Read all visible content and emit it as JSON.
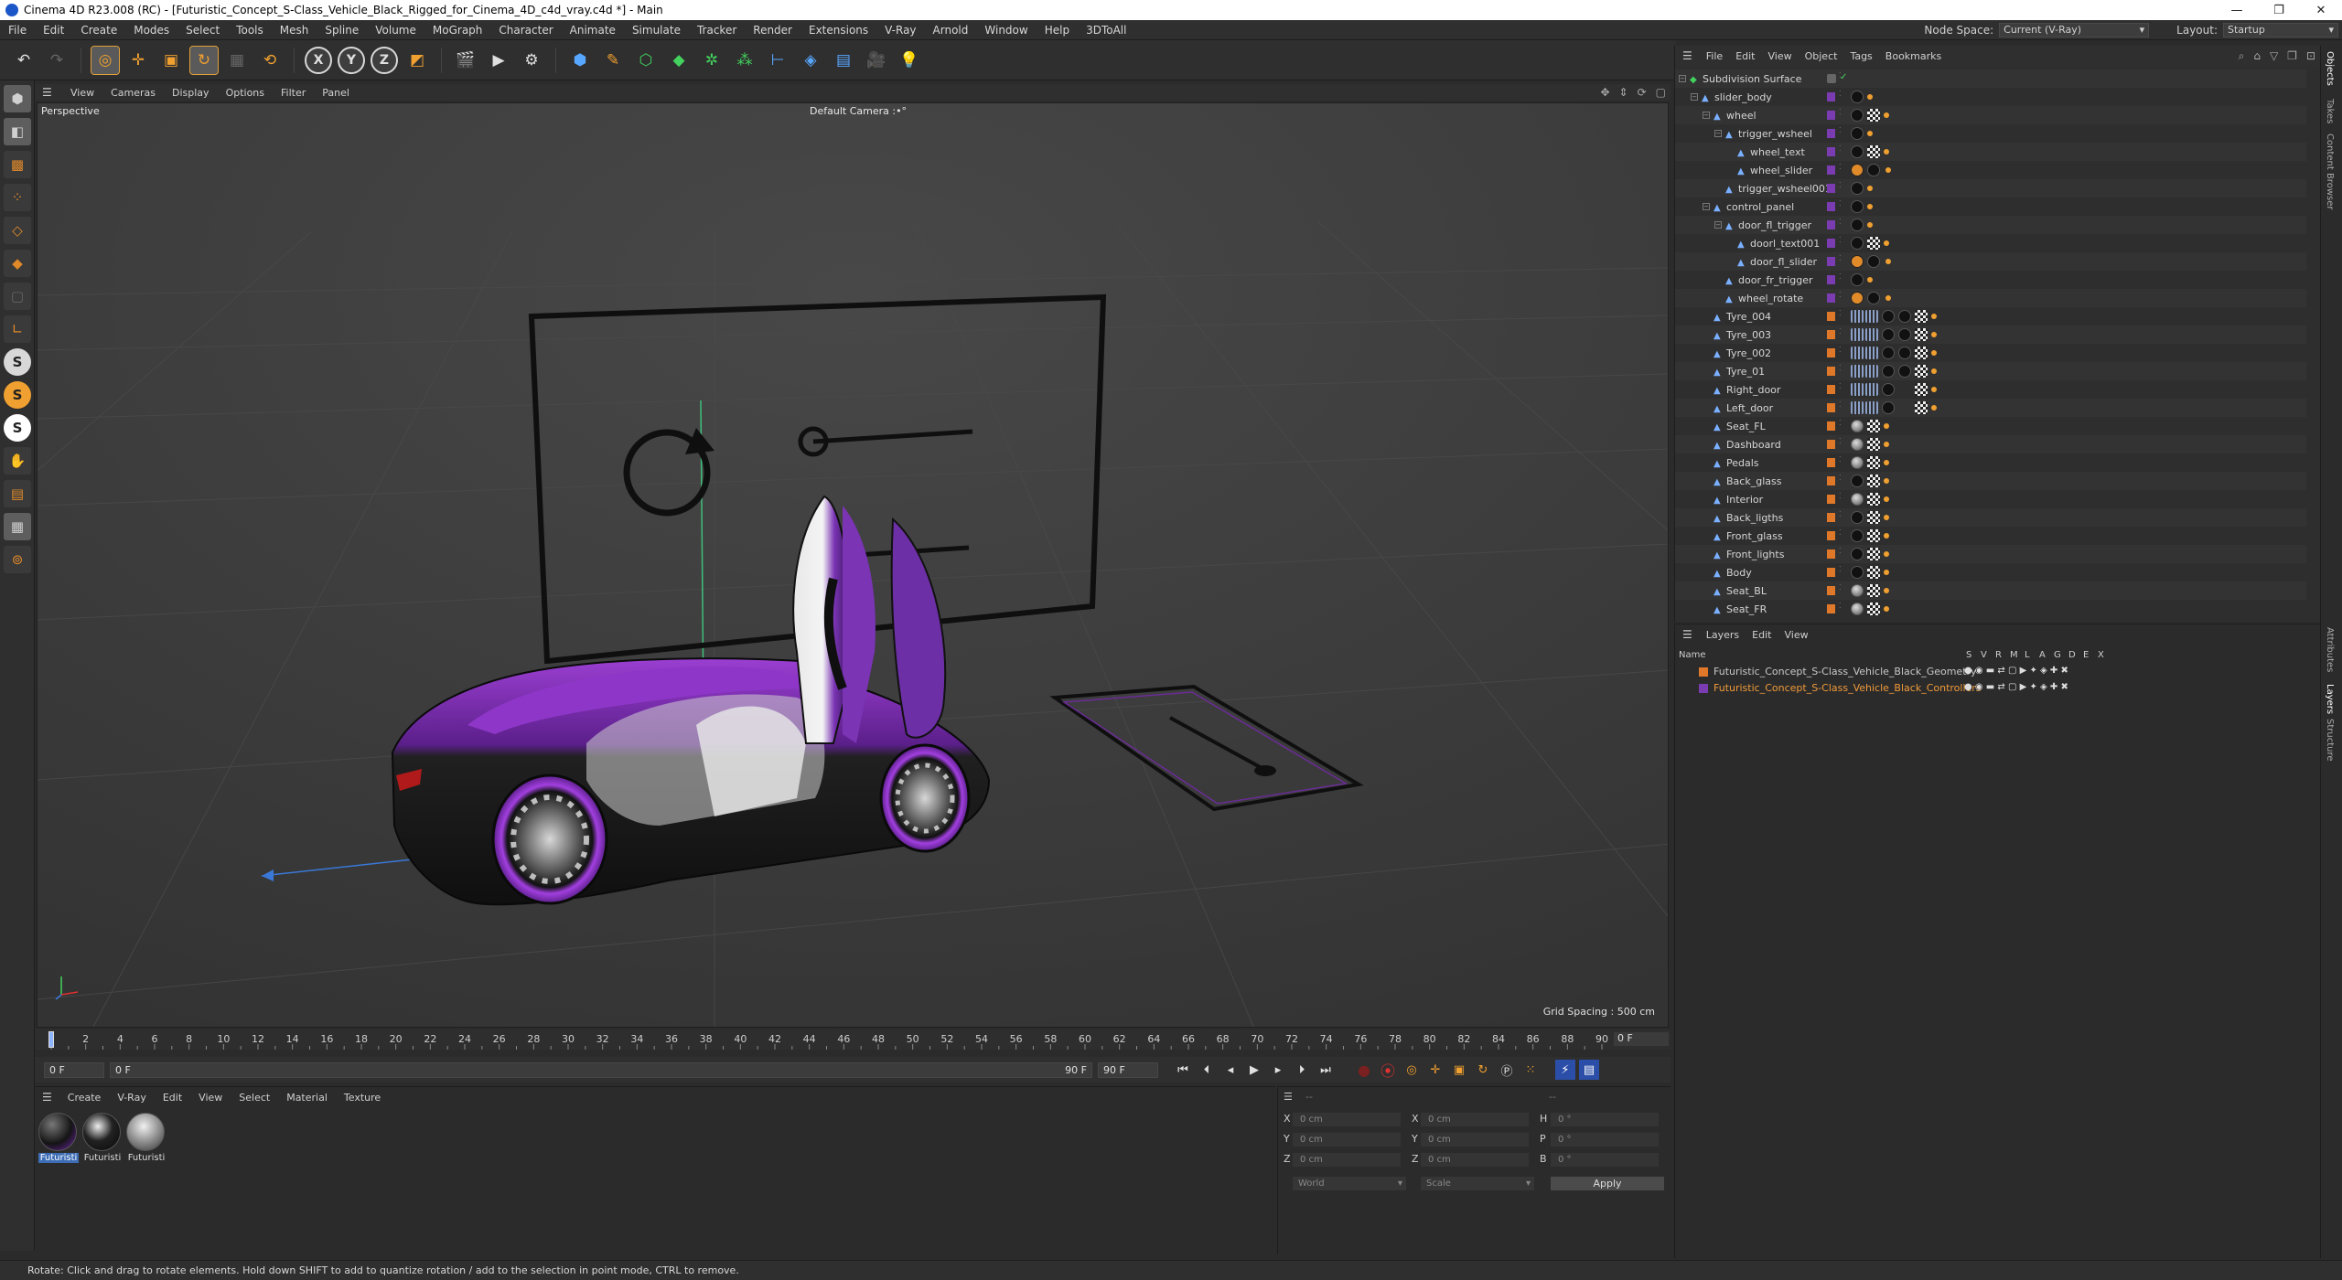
{
  "window": {
    "title": "Cinema 4D R23.008 (RC) - [Futuristic_Concept_S-Class_Vehicle_Black_Rigged_for_Cinema_4D_c4d_vray.c4d *] - Main",
    "minimize": "—",
    "maximize": "❐",
    "close": "✕"
  },
  "menu": [
    "File",
    "Edit",
    "Create",
    "Modes",
    "Select",
    "Tools",
    "Mesh",
    "Spline",
    "Volume",
    "MoGraph",
    "Character",
    "Animate",
    "Simulate",
    "Tracker",
    "Render",
    "Extensions",
    "V-Ray",
    "Arnold",
    "Window",
    "Help",
    "3DToAll"
  ],
  "node_space": {
    "label": "Node Space:",
    "value": "Current (V-Ray)"
  },
  "layout": {
    "label": "Layout:",
    "value": "Startup"
  },
  "toolbar": {
    "axis_x": "X",
    "axis_y": "Y",
    "axis_z": "Z"
  },
  "left_tools": {
    "s1": "S",
    "s2": "S",
    "s3": "S"
  },
  "viewport": {
    "menu": [
      "View",
      "Cameras",
      "Display",
      "Options",
      "Filter",
      "Panel"
    ],
    "view_name": "Perspective",
    "camera_name": "Default Camera",
    "camera_suffix": ":•°",
    "grid_spacing": "Grid Spacing : 500 cm"
  },
  "timeline": {
    "ticks": [
      "0",
      "2",
      "4",
      "6",
      "8",
      "10",
      "12",
      "14",
      "16",
      "18",
      "20",
      "22",
      "24",
      "26",
      "28",
      "30",
      "32",
      "34",
      "36",
      "38",
      "40",
      "42",
      "44",
      "46",
      "48",
      "50",
      "52",
      "54",
      "56",
      "58",
      "60",
      "62",
      "64",
      "66",
      "68",
      "70",
      "72",
      "74",
      "76",
      "78",
      "80",
      "82",
      "84",
      "86",
      "88",
      "90"
    ],
    "current_frame": "0 F",
    "start": "0 F",
    "slider_start": "0 F",
    "slider_end": "90 F",
    "end": "90 F"
  },
  "materials": {
    "menu": [
      "Create",
      "V-Ray",
      "Edit",
      "View",
      "Select",
      "Material",
      "Texture"
    ],
    "items": [
      {
        "label": "Futuristi",
        "selected": true
      },
      {
        "label": "Futuristi",
        "selected": false
      },
      {
        "label": "Futuristi",
        "selected": false
      }
    ]
  },
  "coords": {
    "x": "X",
    "y": "Y",
    "z": "Z",
    "x2": "X",
    "y2": "Y",
    "z2": "Z",
    "h": "H",
    "p": "P",
    "b": "B",
    "pos_x": "0 cm",
    "pos_y": "0 cm",
    "pos_z": "0 cm",
    "size_x": "0 cm",
    "size_y": "0 cm",
    "size_z": "0 cm",
    "rot_h": "0 °",
    "rot_p": "0 °",
    "rot_b": "0 °",
    "dash1": "--",
    "dash2": "--",
    "coord_mode": "World",
    "size_mode": "Scale",
    "apply": "Apply"
  },
  "object_manager": {
    "menu": [
      "File",
      "Edit",
      "View",
      "Object",
      "Tags",
      "Bookmarks"
    ],
    "rows": [
      {
        "name": "Subdivision Surface",
        "depth": 0
      },
      {
        "name": "slider_body",
        "depth": 1
      },
      {
        "name": "wheel",
        "depth": 2
      },
      {
        "name": "trigger_wsheel",
        "depth": 3
      },
      {
        "name": "wheel_text",
        "depth": 4
      },
      {
        "name": "wheel_slider",
        "depth": 4
      },
      {
        "name": "trigger_wsheel001",
        "depth": 3
      },
      {
        "name": "control_panel",
        "depth": 2
      },
      {
        "name": "door_fl_trigger",
        "depth": 3
      },
      {
        "name": "doorl_text001",
        "depth": 4
      },
      {
        "name": "door_fl_slider",
        "depth": 4
      },
      {
        "name": "door_fr_trigger",
        "depth": 3
      },
      {
        "name": "wheel_rotate",
        "depth": 3
      },
      {
        "name": "Tyre_004",
        "depth": 2
      },
      {
        "name": "Tyre_003",
        "depth": 2
      },
      {
        "name": "Tyre_002",
        "depth": 2
      },
      {
        "name": "Tyre_01",
        "depth": 2
      },
      {
        "name": "Right_door",
        "depth": 2
      },
      {
        "name": "Left_door",
        "depth": 2
      },
      {
        "name": "Seat_FL",
        "depth": 2
      },
      {
        "name": "Dashboard",
        "depth": 2
      },
      {
        "name": "Pedals",
        "depth": 2
      },
      {
        "name": "Back_glass",
        "depth": 2
      },
      {
        "name": "Interior",
        "depth": 2
      },
      {
        "name": "Back_ligths",
        "depth": 2
      },
      {
        "name": "Front_glass",
        "depth": 2
      },
      {
        "name": "Front_lights",
        "depth": 2
      },
      {
        "name": "Body",
        "depth": 2
      },
      {
        "name": "Seat_BL",
        "depth": 2
      },
      {
        "name": "Seat_FR",
        "depth": 2
      }
    ]
  },
  "layers": {
    "menu": [
      "Layers",
      "Edit",
      "View"
    ],
    "head_name": "Name",
    "flags": [
      "S",
      "V",
      "R",
      "M",
      "L",
      "A",
      "G",
      "D",
      "E",
      "X"
    ],
    "items": [
      {
        "name": "Futuristic_Concept_S-Class_Vehicle_Black_Geometry",
        "color": "#e0782a",
        "text_color": "#d6d6d6"
      },
      {
        "name": "Futuristic_Concept_S-Class_Vehicle_Black_Controllers",
        "color": "#7a3cb0",
        "text_color": "#f09a3a"
      }
    ]
  },
  "side_tabs": [
    "Objects",
    "Takes",
    "Content Browser",
    "Attributes",
    "Layers",
    "Structure"
  ],
  "status": "Rotate: Click and drag to rotate elements. Hold down SHIFT to add to quantize rotation / add to the selection in point mode, CTRL to remove."
}
